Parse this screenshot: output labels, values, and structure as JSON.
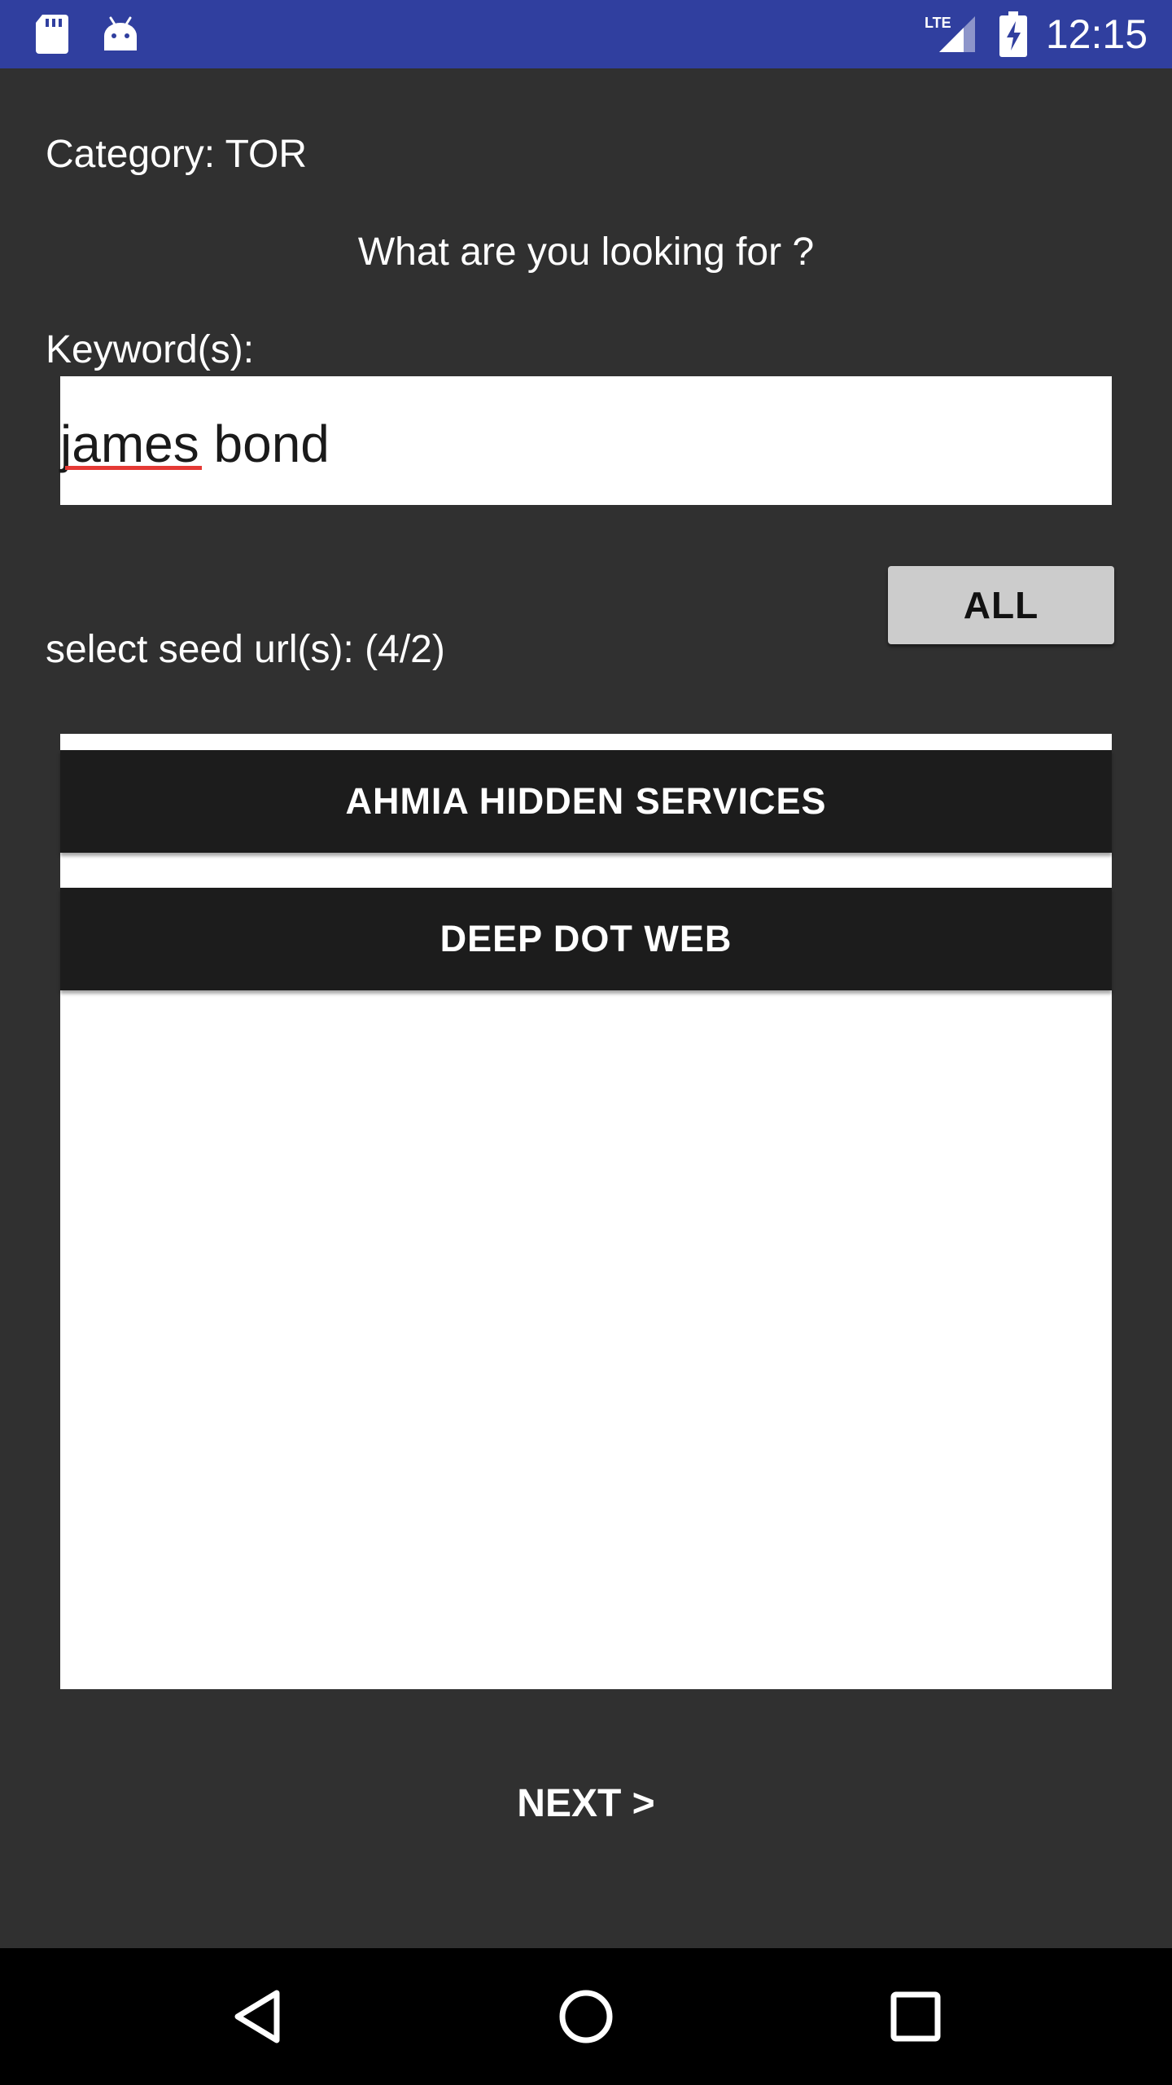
{
  "status_bar": {
    "time": "12:15",
    "network": "LTE",
    "icons": [
      "sd-card-icon",
      "android-icon",
      "lte-signal-icon",
      "battery-charging-icon"
    ]
  },
  "form": {
    "category_label": "Category: TOR",
    "question": "What are you looking for ?",
    "keyword_label": "Keyword(s):",
    "keyword_value": "james bond",
    "all_button_label": "ALL",
    "seed_label": "select seed url(s): (4/2)"
  },
  "seed_urls": [
    {
      "label": "AHMIA HIDDEN SERVICES"
    },
    {
      "label": "DEEP DOT WEB"
    }
  ],
  "next_button_label": "NEXT >",
  "nav_bar": {
    "icons": [
      "back-icon",
      "home-icon",
      "recents-icon"
    ]
  },
  "colors": {
    "status_bar": "#303f9f",
    "background": "#303030",
    "list_item": "#1c1c1c",
    "all_button": "#cccccc",
    "spellcheck": "#e53935"
  }
}
